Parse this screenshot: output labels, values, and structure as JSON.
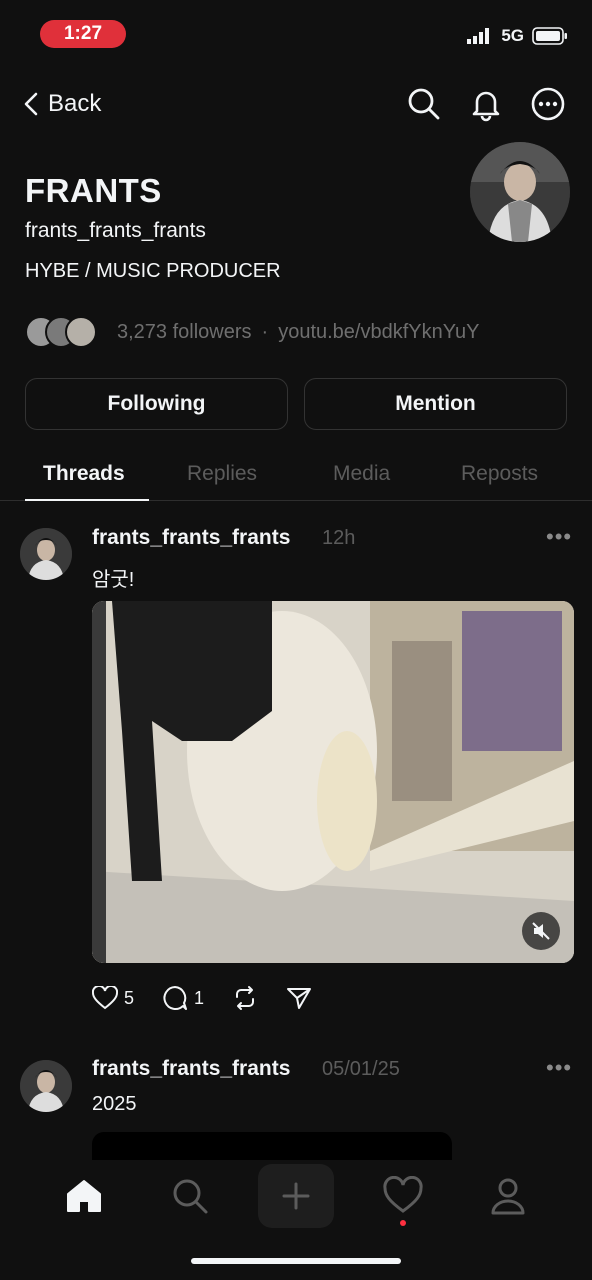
{
  "status_bar": {
    "time": "1:27",
    "network": "5G",
    "time_pill_color": "#e0303a"
  },
  "nav": {
    "back_label": "Back",
    "icons": [
      "search-icon",
      "bell-icon",
      "more-icon"
    ]
  },
  "profile": {
    "name": "FRANTS",
    "handle": "frants_frants_frants",
    "bio": "HYBE / MUSIC PRODUCER",
    "followers_text": "3,273 followers",
    "separator": "·",
    "link": "youtu.be/vbdkfYknYuY"
  },
  "buttons": {
    "following": "Following",
    "mention": "Mention"
  },
  "tabs": [
    {
      "label": "Threads",
      "active": true
    },
    {
      "label": "Replies",
      "active": false
    },
    {
      "label": "Media",
      "active": false
    },
    {
      "label": "Reposts",
      "active": false
    }
  ],
  "posts": [
    {
      "username": "frants_frants_frants",
      "time": "12h",
      "text": "암굿!",
      "has_video": true,
      "likes": "5",
      "replies": "1"
    },
    {
      "username": "frants_frants_frants",
      "time": "05/01/25",
      "text": "2025"
    }
  ],
  "bottom_nav": [
    "home-icon",
    "search-icon",
    "plus-icon",
    "heart-icon",
    "profile-icon"
  ],
  "colors": {
    "background": "#101010",
    "text": "#f3f5f7",
    "muted": "#5c5c5c",
    "notification_dot": "#ff3040"
  }
}
